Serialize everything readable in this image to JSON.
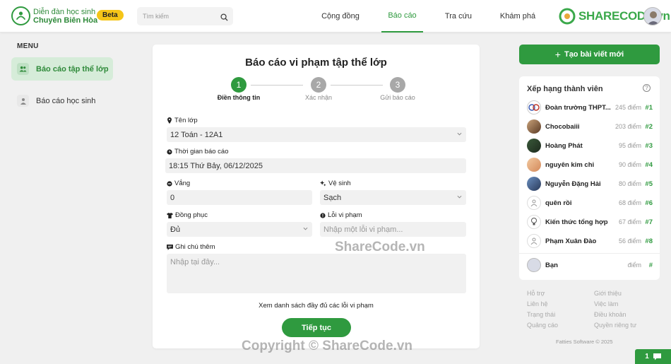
{
  "header": {
    "site_line1": "Diễn đàn học sinh",
    "site_line2": "Chuyên Biên Hòa",
    "beta": "Beta",
    "search_placeholder": "Tìm kiếm",
    "nav": [
      "Cộng đồng",
      "Báo cáo",
      "Tra cứu",
      "Khám phá"
    ],
    "brand": "SHARECODE.vn"
  },
  "sidebar": {
    "title": "MENU",
    "items": [
      {
        "label": "Báo cáo tập thể lớp"
      },
      {
        "label": "Báo cáo học sinh"
      }
    ]
  },
  "form": {
    "title": "Báo cáo vi phạm tập thể lớp",
    "steps": [
      {
        "num": "1",
        "label": "Điền thông tin"
      },
      {
        "num": "2",
        "label": "Xác nhận"
      },
      {
        "num": "3",
        "label": "Gửi báo cáo"
      }
    ],
    "class_label": "Tên lớp",
    "class_value": "12 Toán - 12A1",
    "time_label": "Thời gian báo cáo",
    "time_value": "18:15 Thứ Bảy, 06/12/2025",
    "absent_label": "Vắng",
    "absent_value": "0",
    "hygiene_label": "Vệ sinh",
    "hygiene_value": "Sạch",
    "uniform_label": "Đồng phục",
    "uniform_value": "Đủ",
    "violation_label": "Lỗi vi phạm",
    "violation_placeholder": "Nhập một lỗi vi phạm...",
    "note_label": "Ghi chú thêm",
    "note_placeholder": "Nhập tại đây...",
    "list_link": "Xem danh sách đầy đủ các lỗi vi phạm",
    "next_button": "Tiếp tục"
  },
  "right": {
    "new_post": "Tạo bài viết mới",
    "ranking_title": "Xếp hạng thành viên",
    "ranking": [
      {
        "name": "Đoàn trường THPT...",
        "points": "245 điểm",
        "rank": "#1"
      },
      {
        "name": "Chocobaiii",
        "points": "203 điểm",
        "rank": "#2"
      },
      {
        "name": "Hoàng Phát",
        "points": "95 điểm",
        "rank": "#3"
      },
      {
        "name": "nguyên kim chi",
        "points": "90 điểm",
        "rank": "#4"
      },
      {
        "name": "Nguyễn Đặng Hải",
        "points": "80 điểm",
        "rank": "#5"
      },
      {
        "name": "quên rồi",
        "points": "68 điểm",
        "rank": "#6"
      },
      {
        "name": "Kiến thức tổng hợp",
        "points": "67 điểm",
        "rank": "#7"
      },
      {
        "name": "Phạm Xuân Đào",
        "points": "56 điểm",
        "rank": "#8"
      }
    ],
    "me": {
      "name": "Bạn",
      "points": "điểm",
      "rank": "#"
    },
    "footer_links": [
      "Hỗ trợ",
      "Giới thiệu",
      "Liên hệ",
      "Việc làm",
      "Trạng thái",
      "Điều khoản",
      "Quảng cáo",
      "Quyền riêng tư"
    ],
    "copyright": "Fatties Software © 2025"
  },
  "watermark": {
    "center": "ShareCode.vn",
    "bottom": "Copyright © ShareCode.vn"
  },
  "chat": {
    "count": "1"
  },
  "colors": {
    "accent": "#2f9a3f",
    "beta": "#f5c518",
    "inactive_step": "#a8a8a8"
  }
}
